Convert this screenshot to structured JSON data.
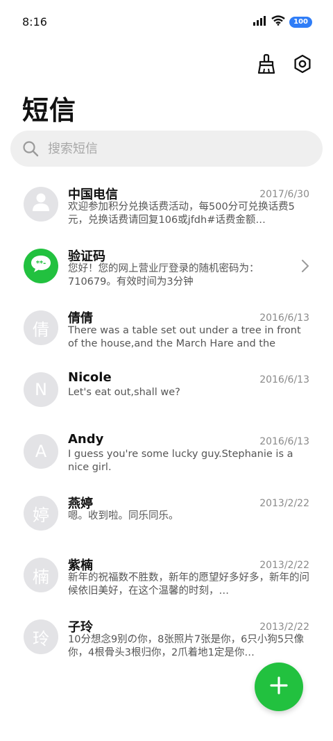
{
  "status_bar": {
    "time": "8:16",
    "battery": "100"
  },
  "header": {
    "title": "短信"
  },
  "search": {
    "placeholder": "搜索短信"
  },
  "messages": [
    {
      "sender": "中国电信",
      "date": "2017/6/30",
      "preview": "欢迎参加积分兑换话费活动，每500分可兑换话费5元，兑换话费请回复106或jfdh#话费金额…",
      "avatar": "person-icon"
    },
    {
      "sender": "验证码",
      "date": "",
      "preview": "您好！您的网上营业厅登录的随机密码为：710679。有效时间为3分钟",
      "avatar": "chat-bubble-icon"
    },
    {
      "sender": "倩倩",
      "date": "2016/6/13",
      "preview": "There was a table set out under a tree in front of the house,and the March Hare and the Hatter we…",
      "avatar_text": "倩"
    },
    {
      "sender": "Nicole",
      "date": "2016/6/13",
      "preview": "Let's eat out,shall we?",
      "avatar_text": "N"
    },
    {
      "sender": "Andy",
      "date": "2016/6/13",
      "preview": "I guess you're some lucky guy.Stephanie is a nice girl.",
      "avatar_text": "A"
    },
    {
      "sender": "燕婷",
      "date": "2013/2/22",
      "preview": "嗯。收到啦。同乐同乐。",
      "avatar_text": "婷"
    },
    {
      "sender": "紫楠",
      "date": "2013/2/22",
      "preview": "新年的祝福数不胜数，新年的愿望好多好多，新年的问候依旧美好，在这个温馨的时刻，…",
      "avatar_text": "楠"
    },
    {
      "sender": "子玲",
      "date": "2013/2/22",
      "preview": "10分想念9别の你，8张照片7张是你，6只小狗5只像你，4根骨头3根归你，2爪着地1定是你…",
      "avatar_text": "玲"
    }
  ],
  "colors": {
    "accent": "#22c13f",
    "avatar_bg": "#e3e3e6",
    "battery": "#2f7df7"
  }
}
